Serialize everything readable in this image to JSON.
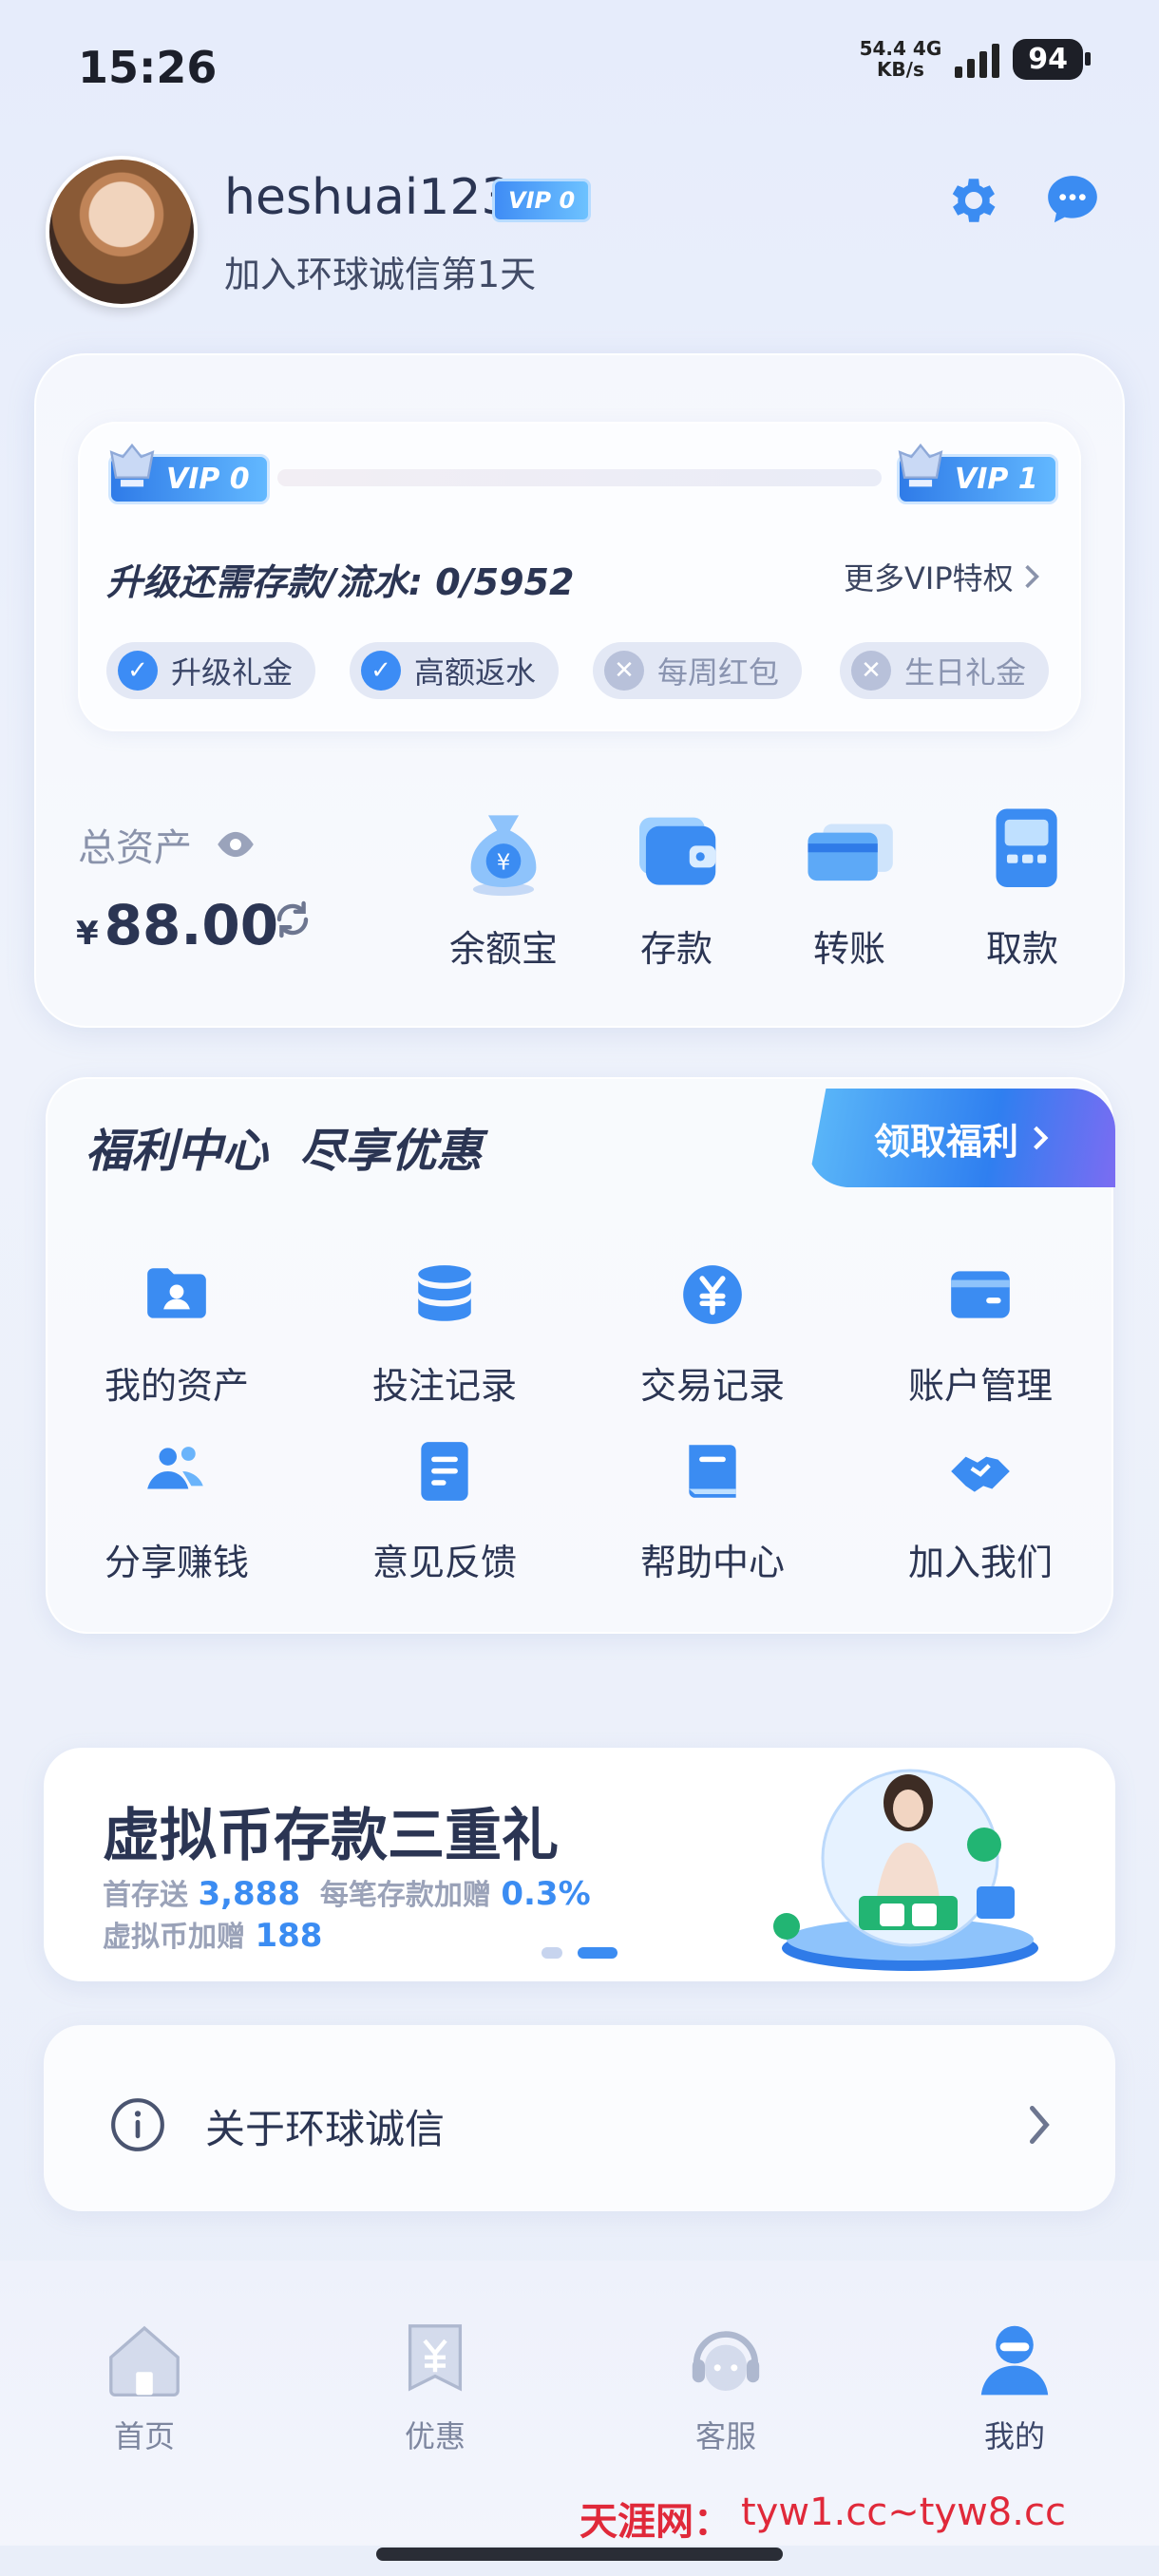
{
  "status_bar": {
    "time": "15:26",
    "net_speed_value": "54.4",
    "net_speed_unit": "KB/s",
    "network": "4G",
    "battery": "94"
  },
  "profile": {
    "username": "heshuai123",
    "vip_badge": "VIP 0",
    "join_text": "加入环球诚信第1天"
  },
  "vip": {
    "current_level": "VIP 0",
    "next_level": "VIP 1",
    "progress": 0,
    "upgrade_text": "升级还需存款/流水: 0/5952",
    "more_link": "更多VIP特权",
    "perks": [
      {
        "label": "升级礼金",
        "enabled": true
      },
      {
        "label": "高额返水",
        "enabled": true
      },
      {
        "label": "每周红包",
        "enabled": false
      },
      {
        "label": "生日礼金",
        "enabled": false
      }
    ]
  },
  "assets": {
    "label": "总资产",
    "currency": "¥",
    "value": "88.00"
  },
  "quick_actions": [
    {
      "label": "余额宝",
      "icon": "money-bag-icon"
    },
    {
      "label": "存款",
      "icon": "wallet-icon"
    },
    {
      "label": "转账",
      "icon": "card-icon"
    },
    {
      "label": "取款",
      "icon": "atm-icon"
    }
  ],
  "benefits": {
    "title": "福利中心  尽享优惠",
    "claim_button": "领取福利",
    "items": [
      {
        "label": "我的资产",
        "icon": "folder-user-icon"
      },
      {
        "label": "投注记录",
        "icon": "database-icon"
      },
      {
        "label": "交易记录",
        "icon": "yen-coin-icon"
      },
      {
        "label": "账户管理",
        "icon": "card-icon"
      },
      {
        "label": "分享赚钱",
        "icon": "share-users-icon"
      },
      {
        "label": "意见反馈",
        "icon": "document-icon"
      },
      {
        "label": "帮助中心",
        "icon": "book-icon"
      },
      {
        "label": "加入我们",
        "icon": "handshake-icon"
      }
    ]
  },
  "banner": {
    "title": "虚拟币存款三重礼",
    "line1_prefix": "首存送",
    "line1_value1": "3,888",
    "line1_mid": "每笔存款加赠",
    "line1_value2": "0.3%",
    "line2_prefix": "虚拟币加赠",
    "line2_value": "188"
  },
  "about": {
    "label": "关于环球诚信"
  },
  "bottom_nav": [
    {
      "label": "首页",
      "icon": "home-icon",
      "active": false
    },
    {
      "label": "优惠",
      "icon": "coupon-icon",
      "active": false
    },
    {
      "label": "客服",
      "icon": "headset-icon",
      "active": false
    },
    {
      "label": "我的",
      "icon": "user-icon",
      "active": true
    }
  ],
  "watermark": {
    "brand": "天涯网：",
    "url": "tyw1.cc~tyw8.cc"
  },
  "colors": {
    "accent": "#3b8cf2",
    "text_primary": "#2b3553",
    "watermark": "#e0293a"
  }
}
